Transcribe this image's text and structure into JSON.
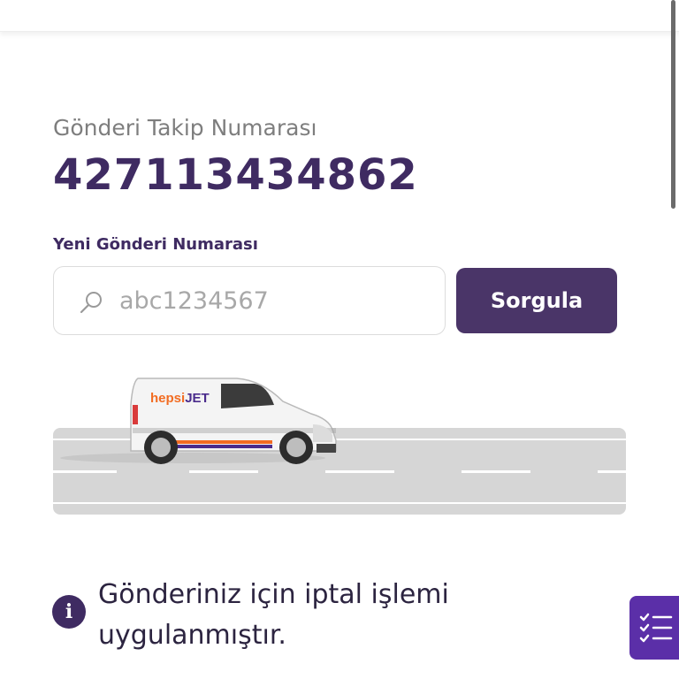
{
  "tracking": {
    "label": "Gönderi Takip Numarası",
    "number": "427113434862"
  },
  "search": {
    "label": "Yeni Gönderi Numarası",
    "placeholder": "abc1234567",
    "value": "",
    "button_label": "Sorgula",
    "icon": "search-icon"
  },
  "illustration": {
    "van_logo_prefix": "hepsi",
    "van_logo_suffix": "JET"
  },
  "status": {
    "icon": "info-icon",
    "message": "Gönderiniz için iptal işlemi uygulanmıştır."
  },
  "floating_button": {
    "icon": "checklist-icon"
  },
  "colors": {
    "brand_purple": "#3f2b62",
    "button_purple": "#4a3568",
    "fab_purple": "#5b2fa8",
    "logo_orange": "#f26c22"
  }
}
